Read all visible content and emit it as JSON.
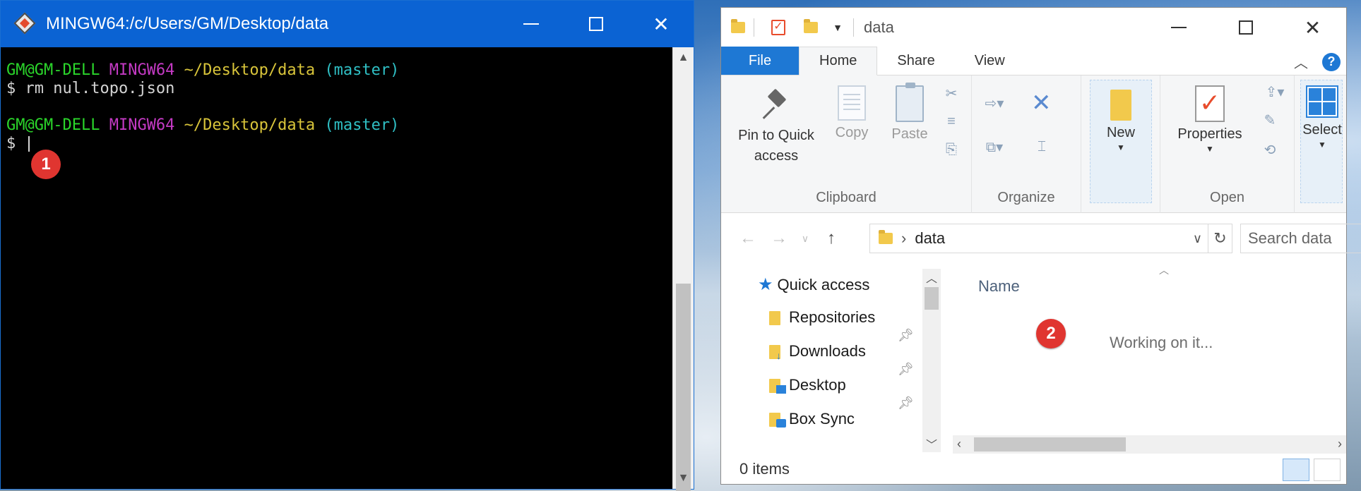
{
  "terminal": {
    "title": "MINGW64:/c/Users/GM/Desktop/data",
    "lines": [
      {
        "user": "GM@GM-DELL",
        "shell": "MINGW64",
        "path": "~/Desktop/data",
        "branch": "(master)"
      },
      {
        "command": "$ rm nul.topo.json"
      },
      {
        "user": "GM@GM-DELL",
        "shell": "MINGW64",
        "path": "~/Desktop/data",
        "branch": "(master)"
      },
      {
        "prompt": "$"
      }
    ],
    "callout": "1"
  },
  "explorer": {
    "title": "data",
    "tabs": [
      "File",
      "Home",
      "Share",
      "View"
    ],
    "help_label": "?",
    "ribbon": {
      "clipboard": {
        "label": "Clipboard",
        "pin_label_1": "Pin to Quick",
        "pin_label_2": "access",
        "copy_label": "Copy",
        "paste_label": "Paste"
      },
      "organize": {
        "label": "Organize"
      },
      "new": {
        "label": "New"
      },
      "open": {
        "label": "Open",
        "properties_label": "Properties"
      },
      "select": {
        "label": "Select"
      }
    },
    "address": {
      "crumb": "data"
    },
    "search": {
      "placeholder": "Search data"
    },
    "nav": {
      "quick_access": "Quick access",
      "items": [
        "Repositories",
        "Downloads",
        "Desktop",
        "Box Sync"
      ]
    },
    "content": {
      "column_name": "Name",
      "status_message": "Working on it...",
      "callout": "2"
    },
    "status": {
      "items": "0 items"
    }
  },
  "colors": {
    "titlebar_blue": "#0b63d3",
    "prompt_user": "#2bd62b",
    "prompt_shell": "#c43ac4",
    "prompt_path": "#d8c43a",
    "prompt_branch": "#2fbfc4",
    "callout_red": "#e03530",
    "file_tab_blue": "#1e78d4"
  }
}
